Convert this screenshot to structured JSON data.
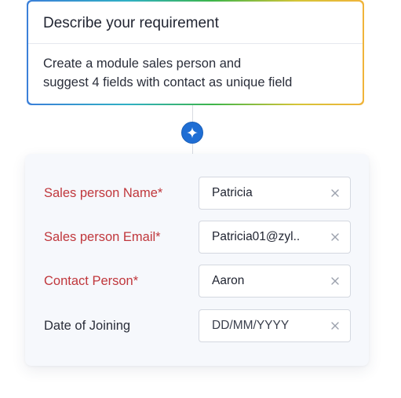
{
  "prompt": {
    "title": "Describe your requirement",
    "text_line1": "Create a module sales person and",
    "text_line2": "suggest 4 fields with contact as unique field"
  },
  "generate_button": {
    "icon": "sparkle-icon"
  },
  "form": {
    "fields": [
      {
        "label": "Sales person Name*",
        "value": "Patricia",
        "required": true
      },
      {
        "label": "Sales person Email*",
        "value": "Patricia01@zyl..",
        "required": true
      },
      {
        "label": "Contact Person*",
        "value": "Aaron",
        "required": true
      },
      {
        "label": "Date of Joining",
        "value": "DD/MM/YYYY",
        "required": false
      }
    ]
  },
  "colors": {
    "required_label": "#c0373c",
    "accent_blue": "#1f6ed4",
    "card_background": "#f6f8fc"
  }
}
